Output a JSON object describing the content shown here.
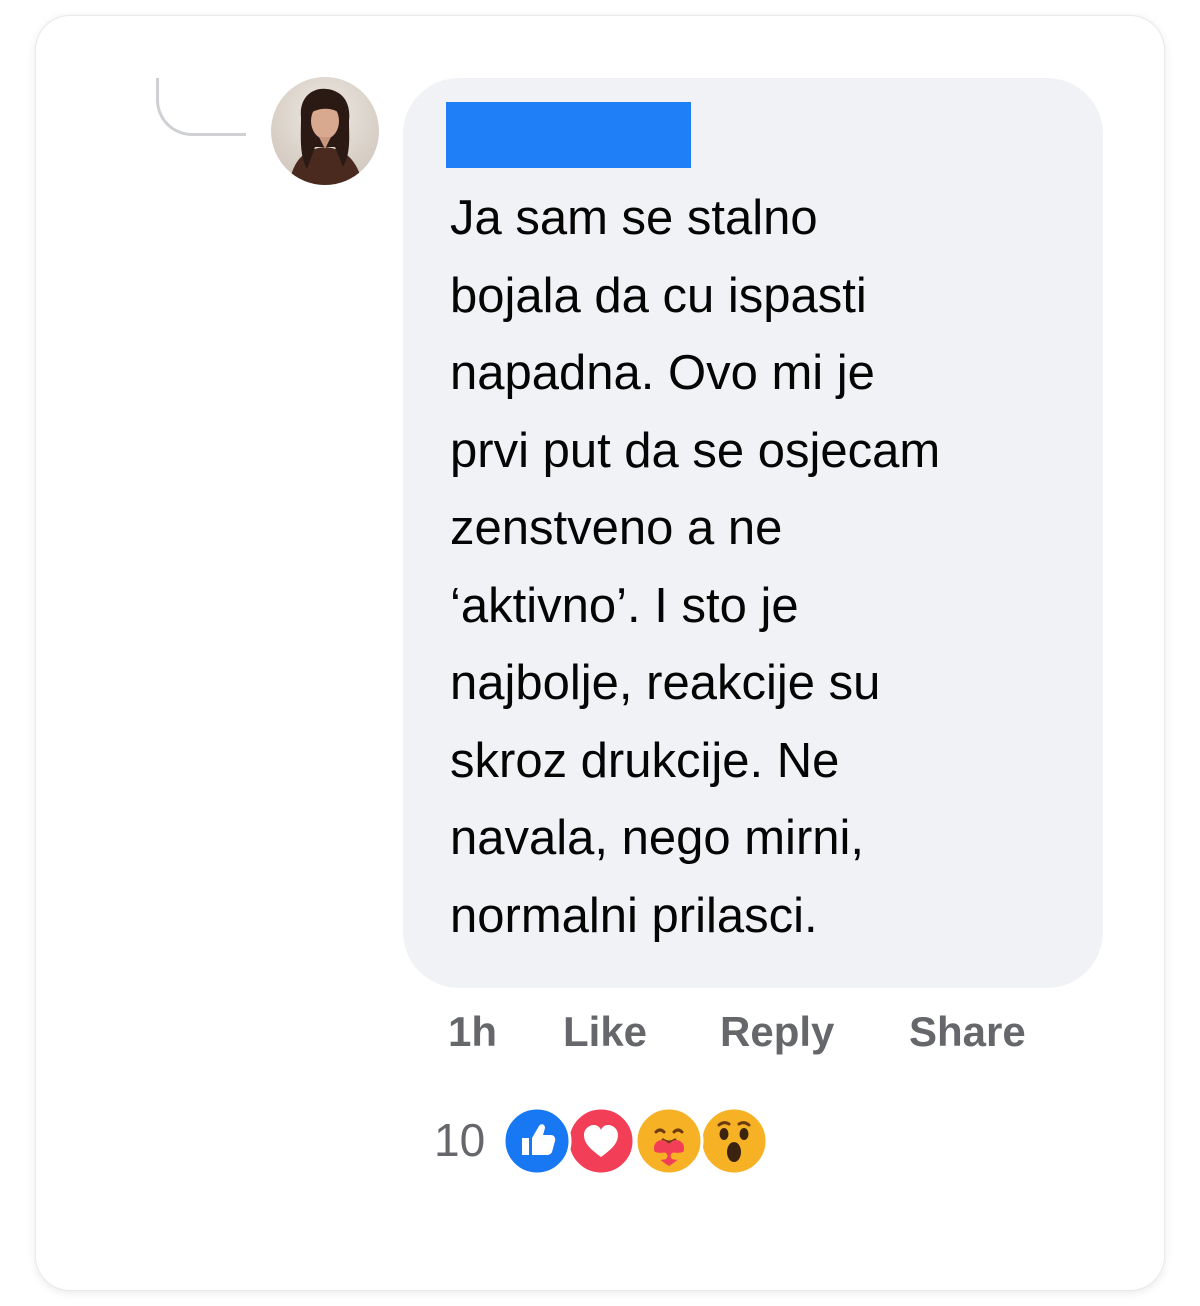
{
  "comment": {
    "author_redacted": true,
    "text": "Ja sam se stalno\nbojala da cu ispasti\nnapadna. Ovo mi je\nprvi put da se osjecam\nzenstveno a ne\n‘aktivno’. I sto je\nnajbolje, reakcije su\nskroz drukcije. Ne\nnavala, nego mirni,\nnormalni prilasci."
  },
  "actions": {
    "time": "1h",
    "like": "Like",
    "reply": "Reply",
    "share": "Share"
  },
  "reactions": {
    "count": "10",
    "types": [
      "like-icon",
      "love-icon",
      "care-icon",
      "wow-icon"
    ]
  },
  "colors": {
    "bubble": "#f0f2f5",
    "redaction": "#1f7ff7",
    "action_text": "#65676b",
    "like": "#1877f2",
    "love": "#f33e58",
    "emoji": "#f7b125"
  }
}
